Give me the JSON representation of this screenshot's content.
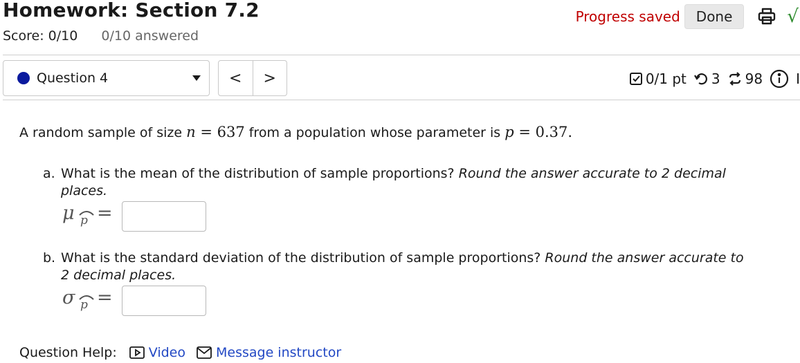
{
  "header": {
    "title": "Homework: Section 7.2",
    "score": "Score: 0/10",
    "answered": "0/10 answered",
    "progress_saved": "Progress saved",
    "done_label": "Done",
    "print_icon": "printer-icon",
    "math_icon": "√"
  },
  "question_nav": {
    "selected": "Question 4",
    "prev": "<",
    "next": ">"
  },
  "question_meta": {
    "points": "0/1 pt",
    "retries": "3",
    "submissions": "98",
    "info_icon": "info-icon",
    "cutoff": "I"
  },
  "problem": {
    "intro_prefix": "A random sample of size ",
    "n_var": "n",
    "n_eq": " = ",
    "n_value": "637",
    "intro_mid": " from a population whose parameter is ",
    "p_var": "p",
    "p_eq": " = ",
    "p_value": "0.37",
    "intro_suffix": "."
  },
  "parts": [
    {
      "label": "a.",
      "question": "What is the mean of the distribution of sample proportions? ",
      "instruction": "Round the answer accurate to 2 decimal places.",
      "symbol": "μ",
      "subscript": "p",
      "equals": "=",
      "value": ""
    },
    {
      "label": "b.",
      "question": "What is the standard deviation of the distribution of sample proportions? ",
      "instruction": "Round the answer accurate to 2 decimal places.",
      "symbol": "σ",
      "subscript": "p",
      "equals": "=",
      "value": ""
    }
  ],
  "help": {
    "label": "Question Help:",
    "video": "Video",
    "message": "Message instructor"
  },
  "colors": {
    "progress": "#c00000",
    "link": "#2248c4",
    "question_dot": "#0a1a9e",
    "check": "#2b8a2b"
  }
}
